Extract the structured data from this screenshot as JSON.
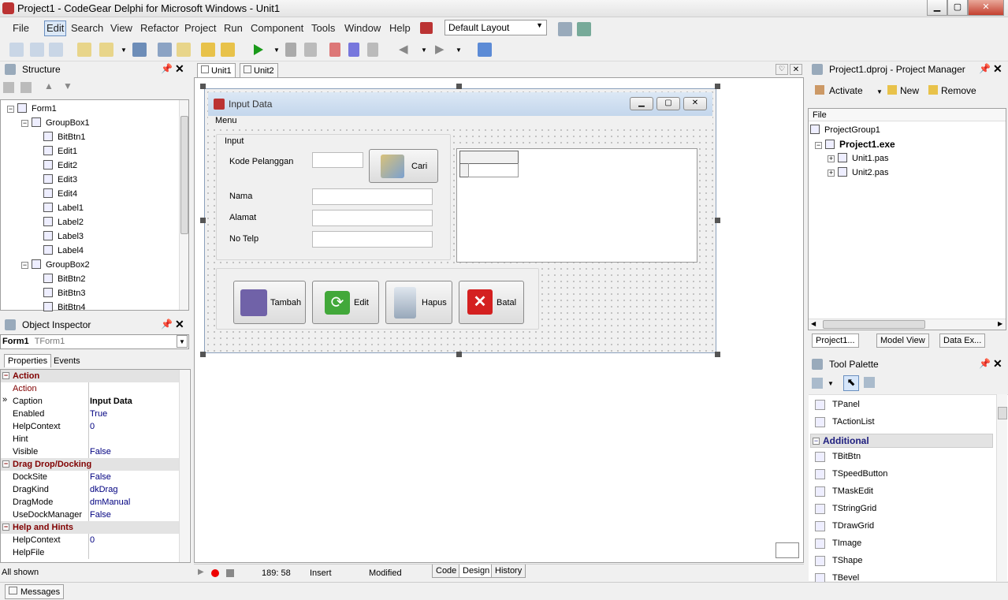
{
  "window": {
    "title": "Project1 - CodeGear Delphi for Microsoft Windows - Unit1"
  },
  "menu": [
    "File",
    "Edit",
    "Search",
    "View",
    "Refactor",
    "Project",
    "Run",
    "Component",
    "Tools",
    "Window",
    "Help"
  ],
  "layout_select": {
    "value": "Default Layout"
  },
  "structure": {
    "title": "Structure",
    "nodes": [
      {
        "label": "Form1",
        "level": 0
      },
      {
        "label": "GroupBox1",
        "level": 1
      },
      {
        "label": "BitBtn1",
        "level": 2
      },
      {
        "label": "Edit1",
        "level": 2
      },
      {
        "label": "Edit2",
        "level": 2
      },
      {
        "label": "Edit3",
        "level": 2
      },
      {
        "label": "Edit4",
        "level": 2
      },
      {
        "label": "Label1",
        "level": 2
      },
      {
        "label": "Label2",
        "level": 2
      },
      {
        "label": "Label3",
        "level": 2
      },
      {
        "label": "Label4",
        "level": 2
      },
      {
        "label": "GroupBox2",
        "level": 1
      },
      {
        "label": "BitBtn2",
        "level": 2
      },
      {
        "label": "BitBtn3",
        "level": 2
      },
      {
        "label": "BitBtn4",
        "level": 2
      }
    ]
  },
  "inspector": {
    "title": "Object Inspector",
    "object_name": "Form1",
    "object_type": "TForm1",
    "tabs": [
      "Properties",
      "Events"
    ],
    "rows": [
      {
        "k": "Action",
        "v": "",
        "cat": true
      },
      {
        "k": "Action",
        "v": "",
        "cat": false,
        "red": true
      },
      {
        "k": "Caption",
        "v": "Input Data",
        "cat": false,
        "sel": true
      },
      {
        "k": "Enabled",
        "v": "True",
        "cat": false
      },
      {
        "k": "HelpContext",
        "v": "0",
        "cat": false
      },
      {
        "k": "Hint",
        "v": "",
        "cat": false
      },
      {
        "k": "Visible",
        "v": "False",
        "cat": false
      },
      {
        "k": "Drag Drop/Docking",
        "v": "",
        "cat": true
      },
      {
        "k": "DockSite",
        "v": "False",
        "cat": false
      },
      {
        "k": "DragKind",
        "v": "dkDrag",
        "cat": false
      },
      {
        "k": "DragMode",
        "v": "dmManual",
        "cat": false
      },
      {
        "k": "UseDockManager",
        "v": "False",
        "cat": false
      },
      {
        "k": "Help and Hints",
        "v": "",
        "cat": true
      },
      {
        "k": "HelpContext",
        "v": "0",
        "cat": false
      },
      {
        "k": "HelpFile",
        "v": "",
        "cat": false
      }
    ],
    "footer": "All shown"
  },
  "editor_tabs": [
    "Unit1",
    "Unit2"
  ],
  "form": {
    "caption": "Input Data",
    "menu_label": "Menu",
    "groupbox_label": "Input",
    "labels": [
      "Kode Pelanggan",
      "Nama",
      "Alamat",
      "No Telp"
    ],
    "search_button": "Cari",
    "buttons": [
      "Tambah",
      "Edit",
      "Hapus",
      "Batal"
    ]
  },
  "statusbar": {
    "position": "189: 58",
    "mode": "Insert",
    "state": "Modified",
    "tabs": [
      "Code",
      "Design",
      "History"
    ]
  },
  "project_manager": {
    "title": "Project1.dproj - Project Manager",
    "toolbar": [
      "Activate",
      "New",
      "Remove"
    ],
    "column": "File",
    "nodes": [
      {
        "label": "ProjectGroup1",
        "level": 0,
        "bold": false
      },
      {
        "label": "Project1.exe",
        "level": 1,
        "bold": true
      },
      {
        "label": "Unit1.pas",
        "level": 2,
        "bold": false
      },
      {
        "label": "Unit2.pas",
        "level": 2,
        "bold": false
      }
    ],
    "bottom_tabs": [
      "Project1...",
      "Model View",
      "Data Ex..."
    ]
  },
  "tool_palette": {
    "title": "Tool Palette",
    "items": [
      {
        "label": "TPanel",
        "cat": false
      },
      {
        "label": "TActionList",
        "cat": false
      },
      {
        "label": "Additional",
        "cat": true
      },
      {
        "label": "TBitBtn",
        "cat": false
      },
      {
        "label": "TSpeedButton",
        "cat": false
      },
      {
        "label": "TMaskEdit",
        "cat": false
      },
      {
        "label": "TStringGrid",
        "cat": false
      },
      {
        "label": "TDrawGrid",
        "cat": false
      },
      {
        "label": "TImage",
        "cat": false
      },
      {
        "label": "TShape",
        "cat": false
      },
      {
        "label": "TBevel",
        "cat": false
      }
    ]
  },
  "messages_tab": "Messages"
}
